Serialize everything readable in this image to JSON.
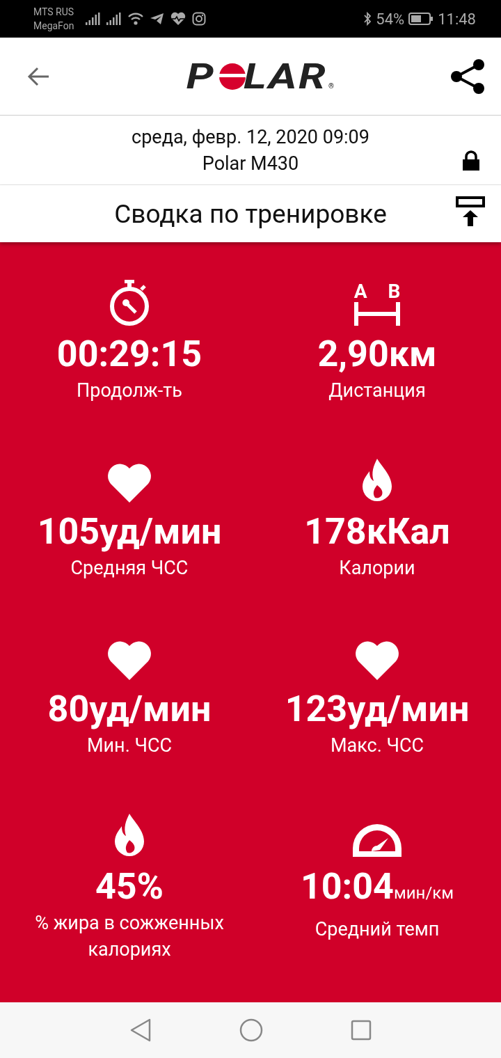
{
  "status_bar": {
    "carriers": [
      "MTS RUS",
      "MegaFon"
    ],
    "battery_percent": "54%",
    "time": "11:48"
  },
  "header": {
    "logo": {
      "before": "P",
      "after": "LAR",
      "mark": "®"
    }
  },
  "session": {
    "date": "среда, февр. 12, 2020 09:09",
    "device": "Polar M430"
  },
  "section_title": "Сводка по тренировке",
  "distance_icon_letters": [
    "A",
    "B"
  ],
  "metrics": [
    {
      "kind": "stopwatch",
      "value": "00:29:15",
      "label": "Продолж-ть"
    },
    {
      "kind": "distance",
      "value": "2,90",
      "unit": "км",
      "label": "Дистанция"
    },
    {
      "kind": "heart",
      "value": "105",
      "unit": "уд/мин",
      "label": "Средняя ЧСС"
    },
    {
      "kind": "flame",
      "value": "178",
      "unit": "кКал",
      "label": "Калории"
    },
    {
      "kind": "heart",
      "value": "80",
      "unit": "уд/мин",
      "label": "Мин. ЧСС"
    },
    {
      "kind": "heart",
      "value": "123",
      "unit": "уд/мин",
      "label": "Макс. ЧСС"
    },
    {
      "kind": "flame",
      "value": "45%",
      "label": "% жира в сожженных калориях"
    },
    {
      "kind": "gauge",
      "value": "10:04",
      "unit": "мин/км",
      "unit_small": true,
      "label": "Средний темп"
    }
  ]
}
